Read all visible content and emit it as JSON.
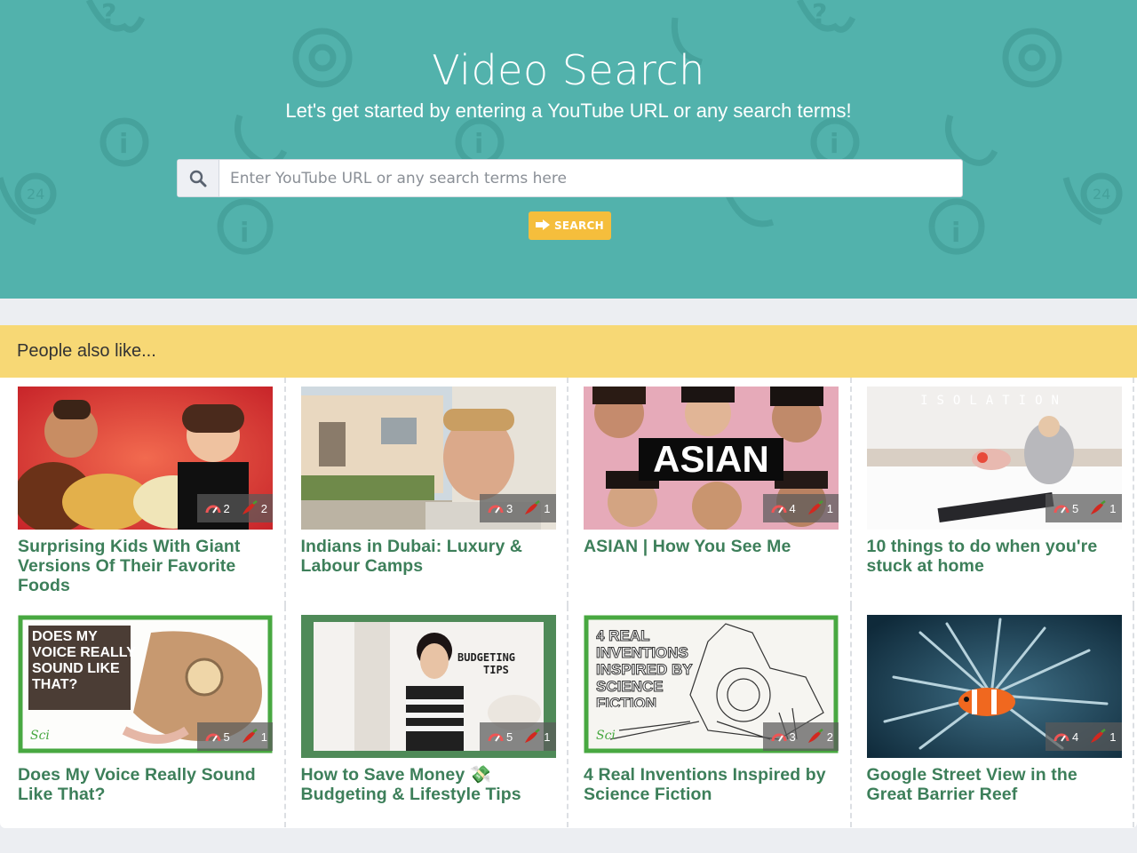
{
  "hero": {
    "title": "Video Search",
    "subtitle": "Let's get started by entering a YouTube URL or any search terms!",
    "background_color": "#52b2ac",
    "search": {
      "placeholder": "Enter YouTube URL or any search terms here",
      "value": "",
      "icon": "search-icon"
    },
    "search_button": {
      "label": "SEARCH",
      "icon": "arrow-right-icon",
      "color": "#f5be3c"
    }
  },
  "suggestions": {
    "header": "People also like...",
    "header_color": "#f7d875",
    "title_color": "#3d7f5a",
    "videos": [
      {
        "title": "Surprising Kids With Giant Versions Of Their Favorite Foods",
        "difficulty": "2",
        "spice": "2"
      },
      {
        "title": "Indians in Dubai: Luxury & Labour Camps",
        "difficulty": "3",
        "spice": "1"
      },
      {
        "title": "ASIAN | How You See Me",
        "difficulty": "4",
        "spice": "1",
        "thumb_text": "ASIAN"
      },
      {
        "title": "10 things to do when you're stuck at home",
        "difficulty": "5",
        "spice": "1",
        "thumb_text": "ISOLATION"
      },
      {
        "title": "Does My Voice Really Sound Like That?",
        "difficulty": "5",
        "spice": "1",
        "thumb_text": "DOES MY VOICE REALLY SOUND LIKE THAT?"
      },
      {
        "title": "How to Save Money 💸 Budgeting & Lifestyle Tips",
        "difficulty": "5",
        "spice": "1",
        "thumb_text": "BUDGETING TIPS"
      },
      {
        "title": "4 Real Inventions Inspired by Science Fiction",
        "difficulty": "3",
        "spice": "2",
        "thumb_text": "4 REAL INVENTIONS INSPIRED BY SCIENCE FICTION"
      },
      {
        "title": "Google Street View in the Great Barrier Reef",
        "difficulty": "4",
        "spice": "1"
      }
    ]
  }
}
